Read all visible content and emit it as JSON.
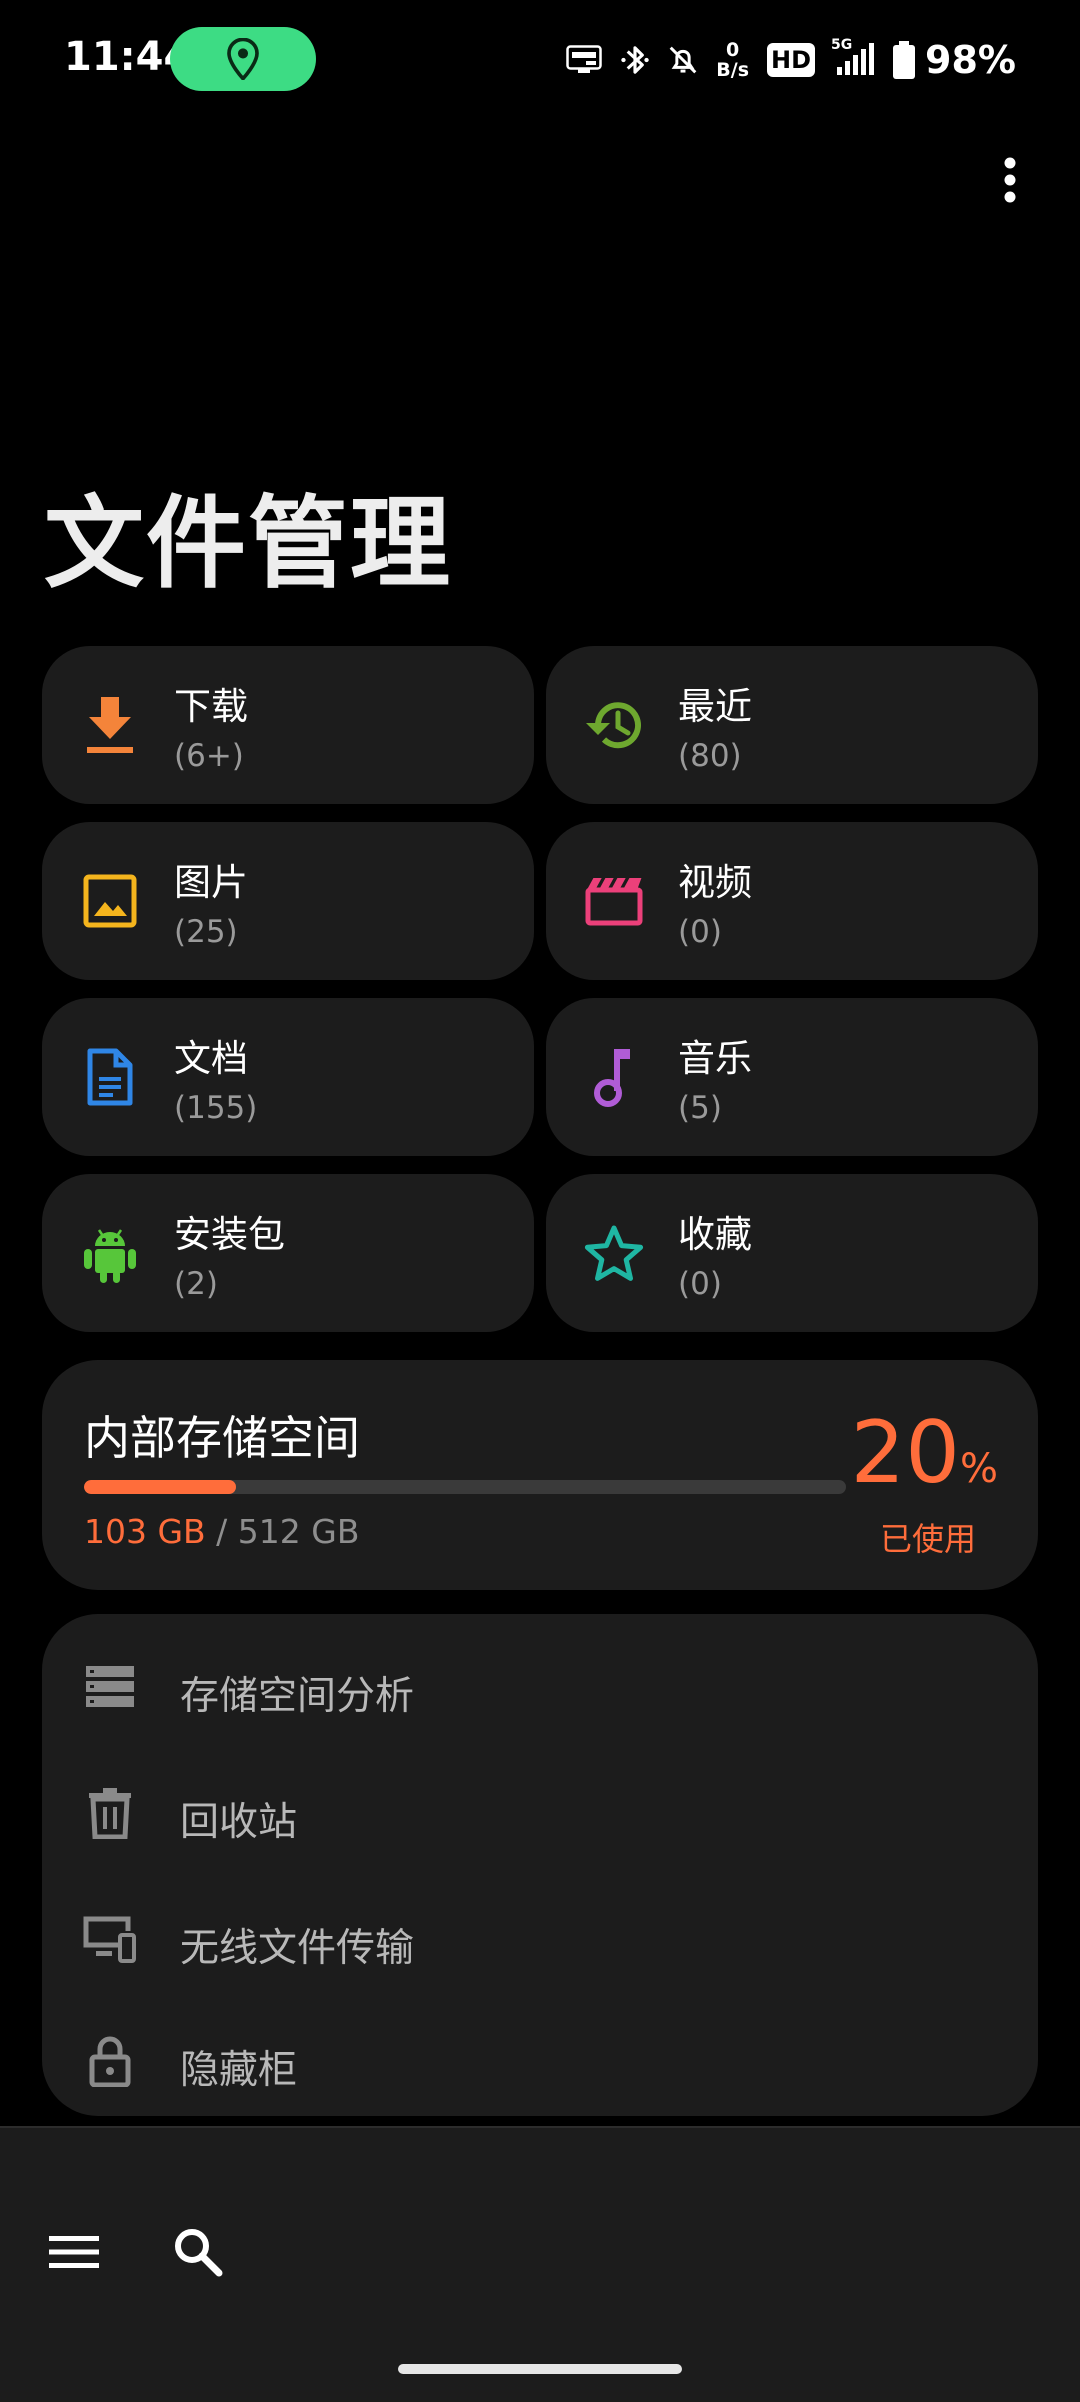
{
  "status_bar": {
    "time": "11:44",
    "speed_value": "0",
    "speed_unit": "B/s",
    "hd_label": "HD",
    "network_label": "5G",
    "battery": "98%"
  },
  "header": {
    "title": "文件管理"
  },
  "categories": [
    {
      "label": "下载",
      "count": "(6+)",
      "icon": "download-icon",
      "color": "#f4843a"
    },
    {
      "label": "最近",
      "count": "(80)",
      "icon": "history-icon",
      "color": "#6ea82f"
    },
    {
      "label": "图片",
      "count": "(25)",
      "icon": "image-icon",
      "color": "#f5b51d"
    },
    {
      "label": "视频",
      "count": "(0)",
      "icon": "video-icon",
      "color": "#ec407a"
    },
    {
      "label": "文档",
      "count": "(155)",
      "icon": "document-icon",
      "color": "#2f86e6"
    },
    {
      "label": "音乐",
      "count": "(5)",
      "icon": "music-icon",
      "color": "#b05cd6"
    },
    {
      "label": "安装包",
      "count": "(2)",
      "icon": "android-icon",
      "color": "#57c63a"
    },
    {
      "label": "收藏",
      "count": "(0)",
      "icon": "star-icon",
      "color": "#1fb6a3"
    }
  ],
  "storage": {
    "title": "内部存储空间",
    "used": "103 GB",
    "separator": " / ",
    "total": "512 GB",
    "percent": "20",
    "percent_sign": "%",
    "percent_fraction": 0.2,
    "used_label": "已使用",
    "accent": "#ff6d3b"
  },
  "tools": [
    {
      "label": "存储空间分析",
      "icon": "storage-analysis-icon"
    },
    {
      "label": "回收站",
      "icon": "trash-icon"
    },
    {
      "label": "无线文件传输",
      "icon": "wireless-transfer-icon"
    },
    {
      "label": "隐藏柜",
      "icon": "lock-icon"
    }
  ],
  "bottom_bar": {
    "menu_icon": "menu-icon",
    "search_icon": "search-icon"
  }
}
